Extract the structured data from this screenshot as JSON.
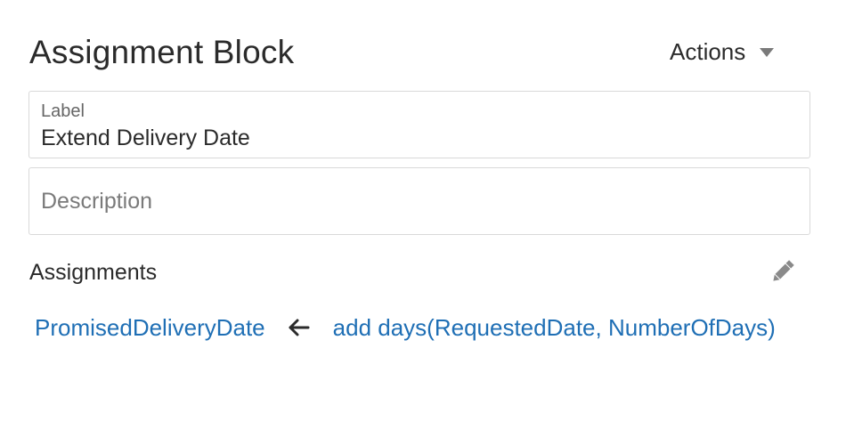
{
  "header": {
    "title": "Assignment Block",
    "actions_label": "Actions"
  },
  "fields": {
    "label": {
      "caption": "Label",
      "value": "Extend Delivery Date"
    },
    "description": {
      "placeholder": "Description",
      "value": ""
    }
  },
  "assignments": {
    "section_title": "Assignments",
    "edit_icon": "pencil-icon",
    "rows": [
      {
        "target": "PromisedDeliveryDate",
        "arrow_icon": "arrow-left-icon",
        "expression": "add days(RequestedDate, NumberOfDays)"
      }
    ]
  },
  "colors": {
    "link": "#1f6fb5",
    "text": "#2b2b2b",
    "border": "#d9d9d9",
    "muted": "#7a7a7a"
  }
}
